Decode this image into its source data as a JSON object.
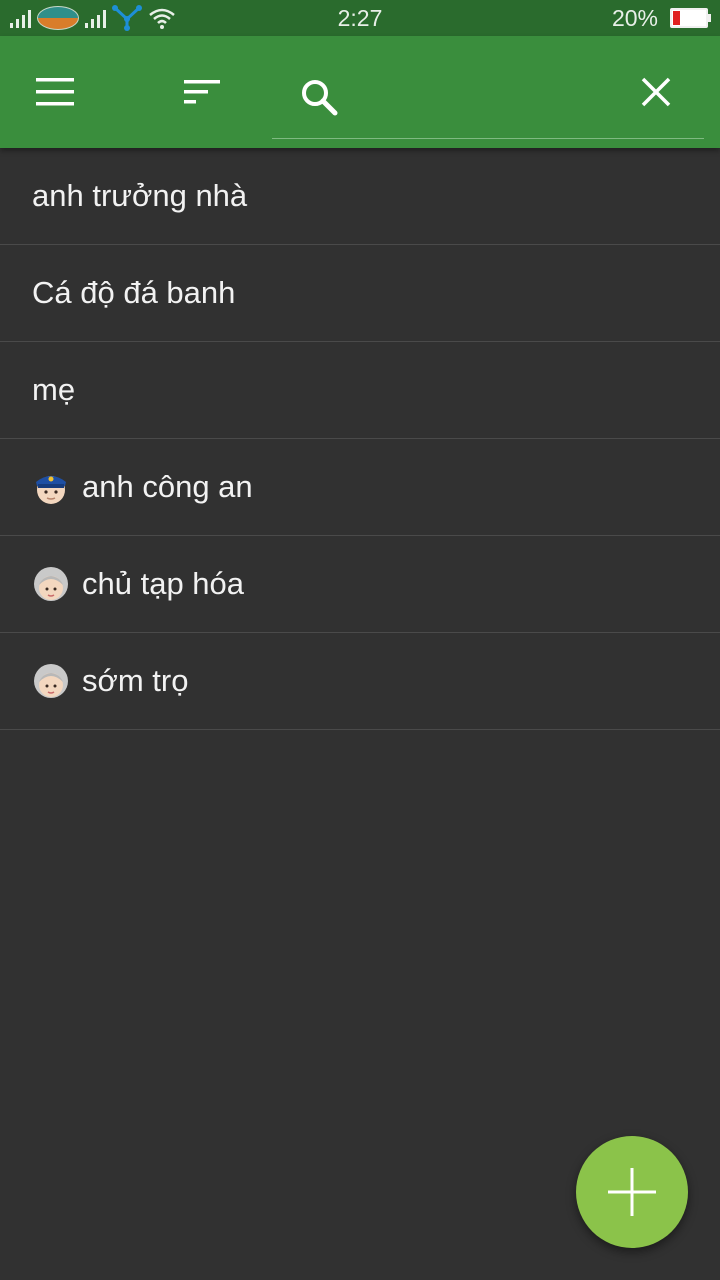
{
  "status_bar": {
    "time": "2:27",
    "battery_percent_text": "20%",
    "battery_level": 0.2,
    "battery_color": "#e02020",
    "icons": [
      "signal-icon",
      "carrier-logo-icon",
      "signal-icon",
      "network-icon",
      "wifi-icon"
    ]
  },
  "toolbar": {
    "background_color": "#3a8e3d",
    "menu_icon": "hamburger-menu-icon",
    "sort_icon": "sort-icon",
    "search_icon": "search-icon",
    "close_icon": "close-icon",
    "search_value": ""
  },
  "list": {
    "items": [
      {
        "label": "anh trưởng nhà",
        "icon": null
      },
      {
        "label": "Cá độ đá banh",
        "icon": null
      },
      {
        "label": "mẹ",
        "icon": null
      },
      {
        "label": "anh công an",
        "icon": "police-officer-emoji-icon"
      },
      {
        "label": "chủ tạp hóa",
        "icon": "old-woman-emoji-icon"
      },
      {
        "label": "sớm trọ",
        "icon": "old-woman-emoji-icon"
      }
    ]
  },
  "fab": {
    "icon": "plus-icon",
    "color": "#8bc34a"
  }
}
